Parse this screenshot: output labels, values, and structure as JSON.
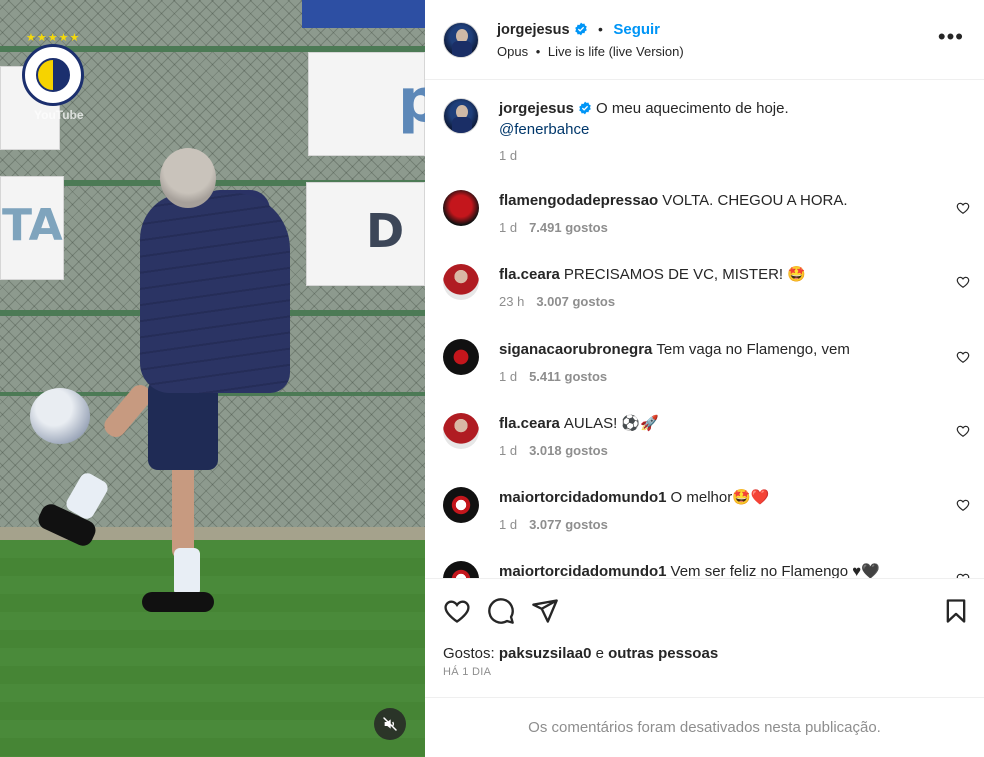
{
  "media": {
    "watermark": "YouTube",
    "mute_icon": "speaker-muted-icon"
  },
  "header": {
    "username": "jorgejesus",
    "separator": "•",
    "follow_label": "Seguir",
    "audio_artist": "Opus",
    "audio_sep": "•",
    "audio_title": "Live is life (live Version)",
    "more_icon": "more-options-icon"
  },
  "caption": {
    "username": "jorgejesus",
    "text": "O meu aquecimento de hoje.",
    "mention": "@fenerbahce",
    "time": "1 d"
  },
  "comments": [
    {
      "username": "flamengodadepressao",
      "text": "VOLTA. CHEGOU A HORA.",
      "time": "1 d",
      "likes": "7.491 gostos"
    },
    {
      "username": "fla.ceara",
      "text": "PRECISAMOS DE VC, MISTER! 🤩",
      "time": "23 h",
      "likes": "3.007 gostos"
    },
    {
      "username": "siganacaorubronegra",
      "text": "Tem vaga no Flamengo, vem",
      "time": "1 d",
      "likes": "5.411 gostos"
    },
    {
      "username": "fla.ceara",
      "text": "AULAS! ⚽🚀",
      "time": "1 d",
      "likes": "3.018 gostos"
    },
    {
      "username": "maiortorcidadomundo1",
      "text": "O melhor🤩❤️",
      "time": "1 d",
      "likes": "3.077 gostos"
    },
    {
      "username": "maiortorcidadomundo1",
      "text": "Vem ser feliz no Flamengo ♥🖤",
      "time": "",
      "likes": ""
    }
  ],
  "actions": {
    "liked_prefix": "Gostos:",
    "liked_user": "paksuzsilaa0",
    "liked_and": "e",
    "liked_others": "outras pessoas",
    "date": "HÁ 1 DIA"
  },
  "footer": {
    "disabled_text": "Os comentários foram desativados nesta publicação."
  },
  "colors": {
    "accent": "#0095f6",
    "verified": "#0095f6",
    "muted_text": "#8e8e8e",
    "text": "#262626",
    "flamengo_red": "#c4161c"
  }
}
